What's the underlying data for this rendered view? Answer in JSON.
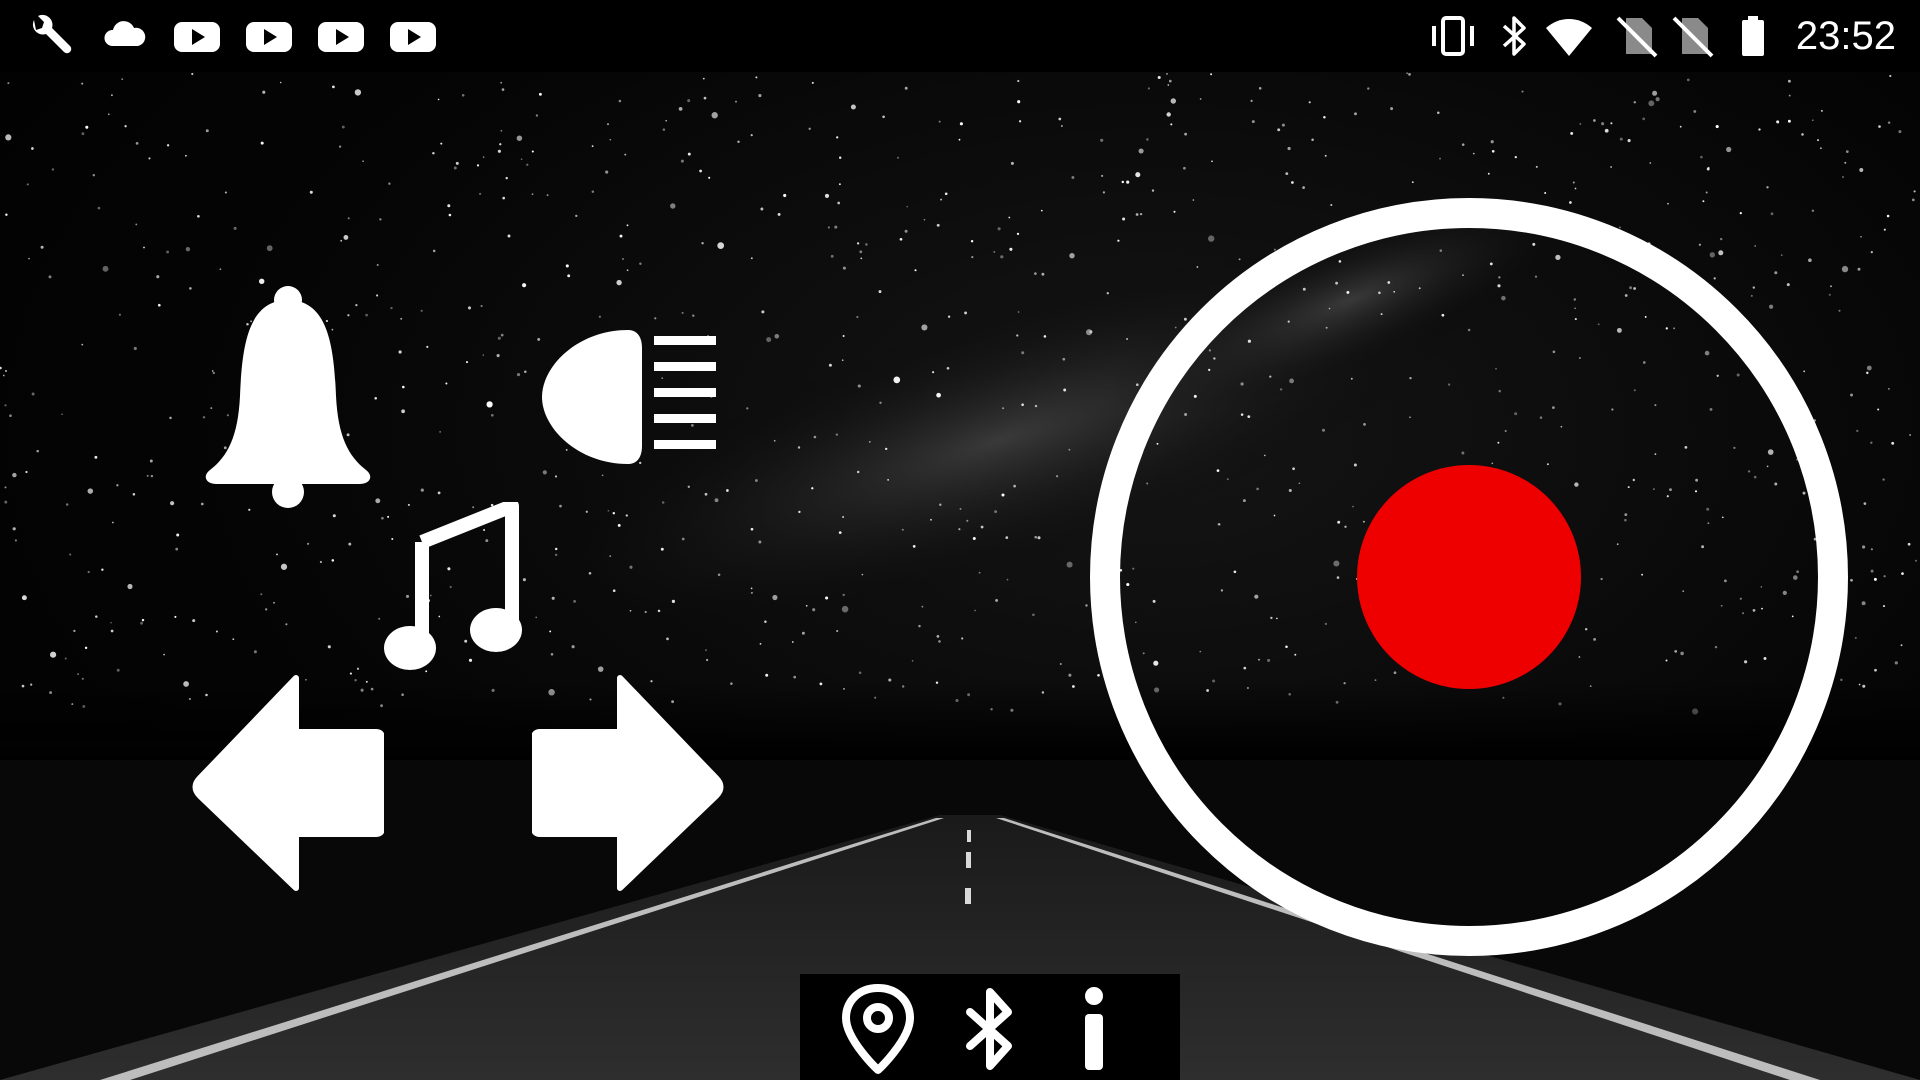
{
  "status_bar": {
    "time": "23:52",
    "left_icons": [
      "wrench-icon",
      "cloud-icon",
      "youtube-icon",
      "youtube-icon",
      "youtube-icon",
      "youtube-icon"
    ],
    "right_icons": [
      "vibrate-icon",
      "bluetooth-icon",
      "wifi-icon",
      "no-sim-icon",
      "no-sim-icon",
      "battery-icon"
    ]
  },
  "controls": {
    "horn": "bell-icon",
    "headlight": "high-beam-icon",
    "music": "music-note-icon",
    "left_signal": "left-arrow-icon",
    "right_signal": "right-arrow-icon",
    "record": "record-button"
  },
  "bottom_bar": {
    "icons": [
      "location-pin-icon",
      "bluetooth-icon",
      "info-icon"
    ]
  },
  "colors": {
    "record_dot": "#ee0000",
    "ring": "#ffffff",
    "background": "#000000"
  }
}
